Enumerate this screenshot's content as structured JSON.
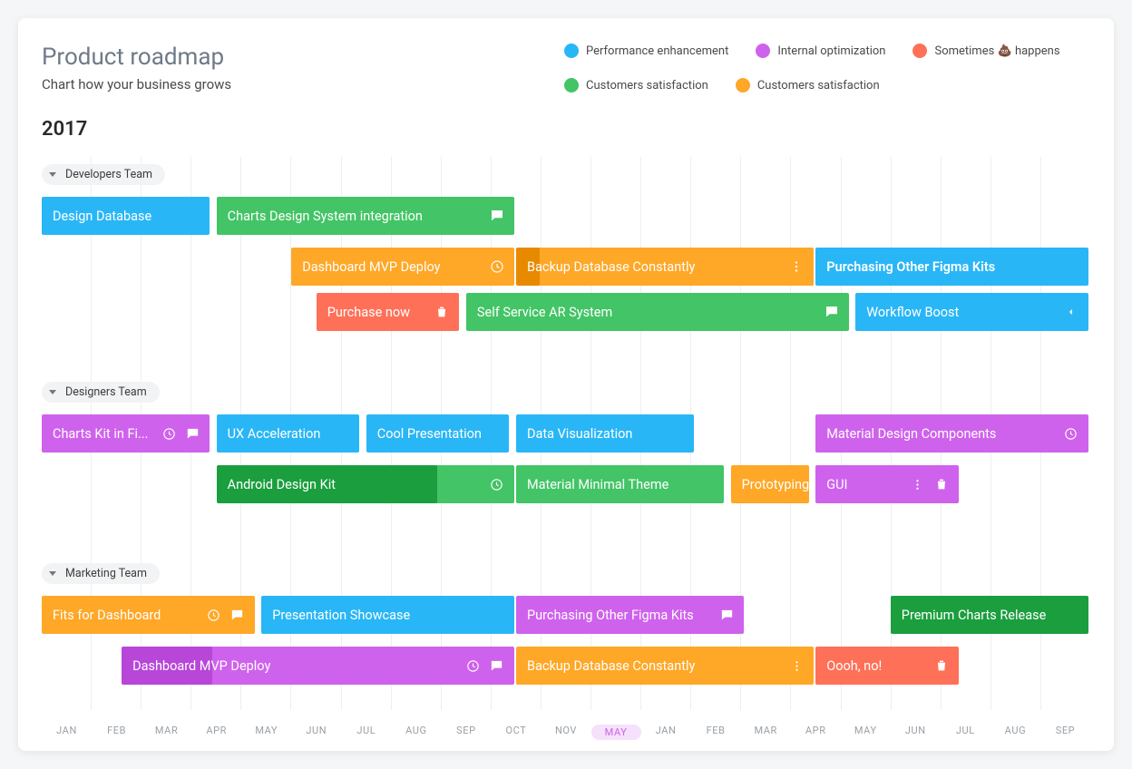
{
  "header": {
    "title": "Product roadmap",
    "subtitle": "Chart how your business grows"
  },
  "legend": [
    {
      "label": "Performance enhancement",
      "color": "#29b6f6"
    },
    {
      "label": "Internal optimization",
      "color": "#cf62ec"
    },
    {
      "label": "Sometimes 💩 happens",
      "color": "#ff7058"
    },
    {
      "label": "Customers satisfaction",
      "color": "#43c466"
    },
    {
      "label": "Customers satisfaction",
      "color": "#ffa726"
    }
  ],
  "year": "2017",
  "groups": [
    {
      "name": "Developers Team"
    },
    {
      "name": "Designers Team"
    },
    {
      "name": "Marketing Team"
    }
  ],
  "bars": {
    "dev": {
      "designDb": "Design Database",
      "chartsDesign": "Charts Design System integration",
      "dashboardMvp": "Dashboard MVP Deploy",
      "backupDb": "Backup Database Constantly",
      "purchasingKits": "Purchasing Other Figma Kits",
      "purchaseNow": "Purchase now",
      "selfService": "Self Service AR System",
      "workflowBoost": "Workflow Boost"
    },
    "des": {
      "chartsKit": "Charts Kit in Fi...",
      "uxAccel": "UX Acceleration",
      "coolPres": "Cool Presentation",
      "dataViz": "Data Visualization",
      "matComp": "Material Design Components",
      "androidKit": "Android Design Kit",
      "matMinimal": "Material Minimal Theme",
      "proto": "Prototyping",
      "gui": "GUI"
    },
    "mkt": {
      "fitsDash": "Fits for Dashboard",
      "presShow": "Presentation Showcase",
      "purchKits": "Purchasing Other Figma Kits",
      "premium": "Premium Charts Release",
      "dashMvp": "Dashboard MVP Deploy",
      "backupDb": "Backup Database Constantly",
      "ooohNo": "Oooh, no!"
    }
  },
  "months": [
    "JAN",
    "FEB",
    "MAR",
    "APR",
    "MAY",
    "JUN",
    "JUL",
    "AUG",
    "SEP",
    "OCT",
    "NOV",
    "MAY",
    "JAN",
    "FEB",
    "MAR",
    "APR",
    "MAY",
    "JUN",
    "JUL",
    "AUG",
    "SEP"
  ],
  "selected_month_index": 11,
  "colors": {
    "blue": "#29b6f6",
    "green": "#43c466",
    "greenDark": "#1b9e3e",
    "magenta": "#cf62ec",
    "orange": "#ffa726",
    "red": "#ff7058"
  },
  "chart_data": {
    "type": "gantt",
    "title": "Product roadmap",
    "year": 2017,
    "x_unit": "months (index 0-20 spanning JAN..SEP over ~21 months)",
    "months": [
      "JAN",
      "FEB",
      "MAR",
      "APR",
      "MAY",
      "JUN",
      "JUL",
      "AUG",
      "SEP",
      "OCT",
      "NOV",
      "MAY",
      "JAN",
      "FEB",
      "MAR",
      "APR",
      "MAY",
      "JUN",
      "JUL",
      "AUG",
      "SEP"
    ],
    "legend": [
      {
        "label": "Performance enhancement",
        "color": "#29b6f6"
      },
      {
        "label": "Internal optimization",
        "color": "#cf62ec"
      },
      {
        "label": "Sometimes 💩 happens",
        "color": "#ff7058"
      },
      {
        "label": "Customers satisfaction",
        "color": "#43c466"
      },
      {
        "label": "Customers satisfaction",
        "color": "#ffa726"
      }
    ],
    "groups": [
      {
        "name": "Developers Team",
        "rows": [
          [
            {
              "label": "Design Database",
              "start": 0,
              "end": 3.4,
              "category": "Performance enhancement",
              "color": "#29b6f6"
            },
            {
              "label": "Charts Design System integration",
              "start": 3.5,
              "end": 9.5,
              "category": "Customers satisfaction",
              "color": "#43c466",
              "icons": [
                "chat"
              ]
            }
          ],
          [
            {
              "label": "Dashboard MVP Deploy",
              "start": 5,
              "end": 9.5,
              "category": "Customers satisfaction",
              "color": "#ffa726",
              "icons": [
                "clock"
              ]
            },
            {
              "label": "Backup Database Constantly",
              "start": 9.5,
              "end": 15.5,
              "category": "Customers satisfaction",
              "color": "#ffa726",
              "progress_overlay": 0.08,
              "icons": [
                "more"
              ]
            },
            {
              "label": "Purchasing Other Figma Kits",
              "start": 15.5,
              "end": 21,
              "category": "Performance enhancement",
              "color": "#29b6f6",
              "bold": true
            }
          ],
          [
            {
              "label": "Purchase now",
              "start": 5.5,
              "end": 8.4,
              "category": "Sometimes happens",
              "color": "#ff7058",
              "icons": [
                "trash"
              ]
            },
            {
              "label": "Self Service AR System",
              "start": 8.5,
              "end": 16.2,
              "category": "Customers satisfaction",
              "color": "#43c466",
              "icons": [
                "chat"
              ]
            },
            {
              "label": "Workflow Boost",
              "start": 16.3,
              "end": 21,
              "category": "Performance enhancement",
              "color": "#29b6f6",
              "icons": [
                "caret-left"
              ]
            }
          ]
        ]
      },
      {
        "name": "Designers Team",
        "rows": [
          [
            {
              "label": "Charts Kit in Fi...",
              "start": 0,
              "end": 3.4,
              "category": "Internal optimization",
              "color": "#cf62ec",
              "icons": [
                "clock",
                "chat"
              ]
            },
            {
              "label": "UX Acceleration",
              "start": 3.5,
              "end": 6.4,
              "category": "Performance enhancement",
              "color": "#29b6f6"
            },
            {
              "label": "Cool Presentation",
              "start": 6.5,
              "end": 9.4,
              "category": "Performance enhancement",
              "color": "#29b6f6"
            },
            {
              "label": "Data Visualization",
              "start": 9.5,
              "end": 13.1,
              "category": "Performance enhancement",
              "color": "#29b6f6"
            },
            {
              "label": "Material Design Components",
              "start": 15.5,
              "end": 21,
              "category": "Internal optimization",
              "color": "#cf62ec",
              "icons": [
                "clock"
              ]
            }
          ],
          [
            {
              "label": "Android Design Kit",
              "start": 3.5,
              "end": 9.5,
              "category": "Customers satisfaction",
              "color": "#1b9e3e",
              "progress_fill_pct": 74,
              "icons": [
                "clock"
              ]
            },
            {
              "label": "Material Minimal Theme",
              "start": 9.5,
              "end": 13.7,
              "category": "Customers satisfaction",
              "color": "#43c466"
            },
            {
              "label": "Prototyping",
              "start": 13.8,
              "end": 15.4,
              "category": "Customers satisfaction",
              "color": "#ffa726"
            },
            {
              "label": "GUI",
              "start": 15.5,
              "end": 18.4,
              "category": "Internal optimization",
              "color": "#cf62ec",
              "icons": [
                "more",
                "trash"
              ]
            }
          ]
        ]
      },
      {
        "name": "Marketing Team",
        "rows": [
          [
            {
              "label": "Fits for Dashboard",
              "start": 0,
              "end": 4.3,
              "category": "Customers satisfaction",
              "color": "#ffa726",
              "icons": [
                "clock",
                "chat"
              ]
            },
            {
              "label": "Presentation Showcase",
              "start": 4.4,
              "end": 9.5,
              "category": "Performance enhancement",
              "color": "#29b6f6"
            },
            {
              "label": "Purchasing Other Figma Kits",
              "start": 9.5,
              "end": 14.1,
              "category": "Internal optimization",
              "color": "#cf62ec",
              "icons": [
                "chat"
              ]
            },
            {
              "label": "Premium Charts Release",
              "start": 17.0,
              "end": 21,
              "category": "Customers satisfaction",
              "color": "#1b9e3e"
            }
          ],
          [
            {
              "label": "Dashboard MVP Deploy",
              "start": 1.6,
              "end": 9.5,
              "category": "Internal optimization",
              "color": "#cf62ec",
              "progress_fill_pct": 23,
              "icons": [
                "clock",
                "chat"
              ]
            },
            {
              "label": "Backup Database Constantly",
              "start": 9.5,
              "end": 15.5,
              "category": "Customers satisfaction",
              "color": "#ffa726",
              "icons": [
                "more"
              ]
            },
            {
              "label": "Oooh, no!",
              "start": 15.5,
              "end": 18.4,
              "category": "Sometimes happens",
              "color": "#ff7058",
              "icons": [
                "trash"
              ]
            }
          ]
        ]
      }
    ]
  }
}
